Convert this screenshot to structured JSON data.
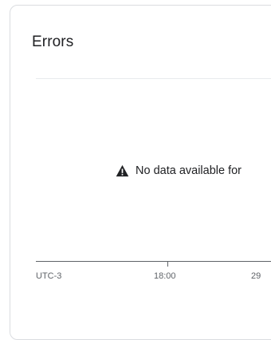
{
  "card": {
    "title": "Errors",
    "empty_message": "No data available for",
    "empty_icon": "warning-icon"
  },
  "axis": {
    "timezone_label": "UTC-3",
    "tick_labels": [
      "18:00",
      "29"
    ]
  },
  "colors": {
    "card_border": "#dadce0",
    "text_primary": "#202124",
    "text_secondary": "#5f6368"
  }
}
